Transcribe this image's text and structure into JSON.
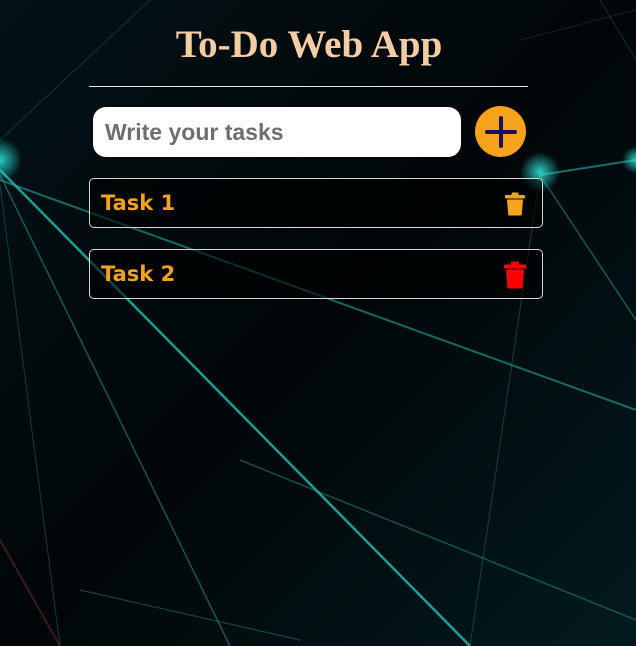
{
  "app": {
    "title": "To-Do Web App"
  },
  "input": {
    "placeholder": "Write your tasks",
    "value": ""
  },
  "add_button": {
    "icon": "plus-icon",
    "color": "#f7a21b",
    "icon_color": "#1a1060"
  },
  "tasks": [
    {
      "label": "Task 1",
      "delete_icon": "trash-icon",
      "delete_color": "#f7a21b"
    },
    {
      "label": "Task 2",
      "delete_icon": "trash-icon",
      "delete_color": "#ff0000"
    }
  ],
  "colors": {
    "title": "#f4cda4",
    "task_text": "#f7a21b",
    "background": "#020a0c",
    "accent_lines": "#1fb8b0"
  }
}
